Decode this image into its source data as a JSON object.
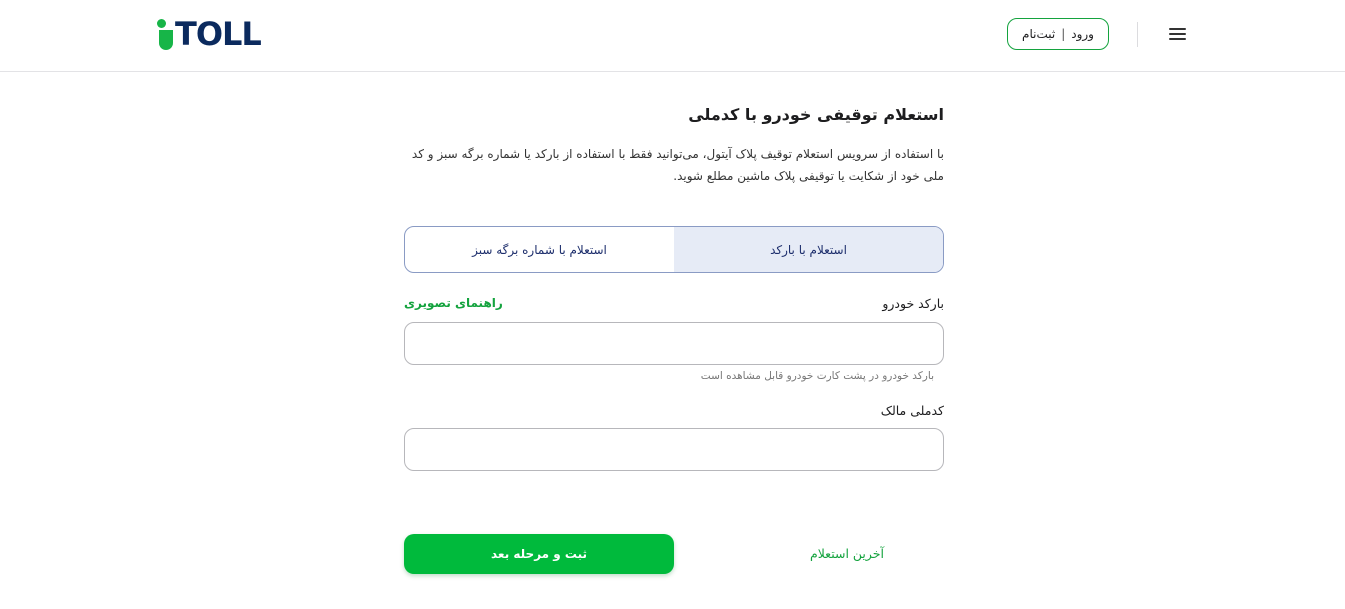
{
  "header": {
    "logo_text": "TOLL",
    "login_label": "ورود",
    "separator": "|",
    "register_label": "ثبت‌نام"
  },
  "main": {
    "title": "استعلام توقیفی خودرو با کدملی",
    "description": "با استفاده از سرویس استعلام توقیف پلاک آیتول، می‌توانید فقط با استفاده از بارکد یا شماره برگه سبز و کد ملی خود از شکایت یا توقیفی پلاک ماشین مطلع شوید.",
    "tabs": [
      {
        "label": "استعلام با بارکد",
        "active": true
      },
      {
        "label": "استعلام با شماره برگه سبز",
        "active": false
      }
    ],
    "barcode_field": {
      "label": "بارکد خودرو",
      "value": "",
      "hint": "بارکد خودرو در پشت کارت خودرو قابل مشاهده است"
    },
    "guide_link": "راهنمای تصویری",
    "national_code_field": {
      "label": "کدملی مالک",
      "value": ""
    },
    "submit_label": "ثبت و مرحله بعد",
    "last_inquiry_label": "آخرین استعلام"
  },
  "colors": {
    "brand_green": "#00ba3c",
    "brand_navy": "#0b2a5e",
    "tab_active_bg": "#e6ebf6"
  }
}
